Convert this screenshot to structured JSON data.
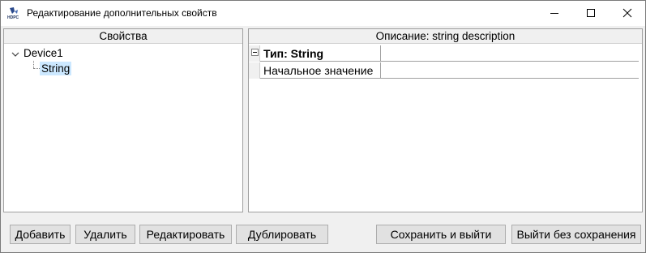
{
  "window": {
    "title": "Редактирование дополнительных свойств",
    "icon": "hdpc-app-icon",
    "controls": [
      "minimize-icon",
      "maximize-icon",
      "close-icon"
    ]
  },
  "left_panel": {
    "header": "Свойства",
    "tree": {
      "root": {
        "label": "Device1",
        "expanded": true
      },
      "children": [
        {
          "label": "String",
          "selected": true
        }
      ]
    }
  },
  "right_panel": {
    "header": "Описание: string description",
    "grid": [
      {
        "name": "Тип: String",
        "value": "",
        "bold": true,
        "collapsible": true
      },
      {
        "name": "Начальное значение",
        "value": ""
      }
    ]
  },
  "buttons": {
    "add": "Добавить",
    "delete": "Удалить",
    "edit": "Редактировать",
    "duplicate": "Дублировать",
    "save_exit": "Сохранить и выйти",
    "exit_no_save": "Выйти без сохранения"
  },
  "colors": {
    "selection": "#cce8ff",
    "window_bg": "#f0f0f0",
    "button_bg": "#e1e1e1"
  }
}
